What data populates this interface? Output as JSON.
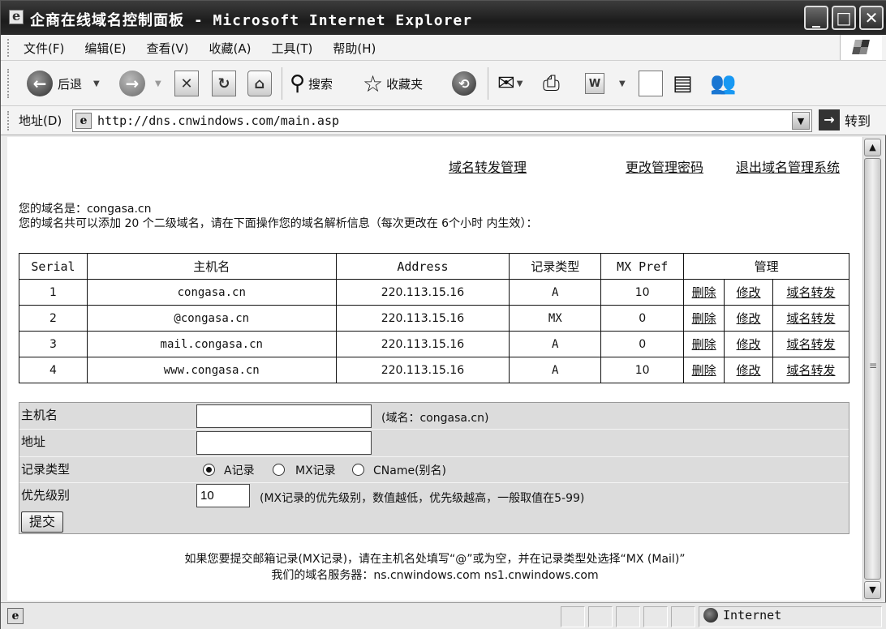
{
  "window": {
    "title": "企商在线域名控制面板 - Microsoft Internet Explorer"
  },
  "menu": [
    "文件(F)",
    "编辑(E)",
    "查看(V)",
    "收藏(A)",
    "工具(T)",
    "帮助(H)"
  ],
  "toolbar": {
    "back_label": "后退",
    "search_label": "搜索",
    "favorites_label": "收藏夹"
  },
  "address": {
    "label": "地址(D)",
    "url": "http://dns.cnwindows.com/main.asp",
    "go_label": "转到"
  },
  "page": {
    "links": [
      "域名转发管理",
      "更改管理密码",
      "退出域名管理系统"
    ],
    "domain_line": "您的域名是：congasa.cn",
    "limit_line": "您的域名共可以添加 20 个二级域名，请在下面操作您的域名解析信息（每次更改在 6个小时 内生效）：",
    "table": {
      "headers": [
        "Serial",
        "主机名",
        "Address",
        "记录类型",
        "MX Pref",
        "管理"
      ],
      "actions": [
        "删除",
        "修改",
        "域名转发"
      ],
      "rows": [
        {
          "serial": "1",
          "host": "congasa.cn",
          "address": "220.113.15.16",
          "type": "A",
          "pref": "10"
        },
        {
          "serial": "2",
          "host": "@congasa.cn",
          "address": "220.113.15.16",
          "type": "MX",
          "pref": "0"
        },
        {
          "serial": "3",
          "host": "mail.congasa.cn",
          "address": "220.113.15.16",
          "type": "A",
          "pref": "0"
        },
        {
          "serial": "4",
          "host": "www.congasa.cn",
          "address": "220.113.15.16",
          "type": "A",
          "pref": "10"
        }
      ]
    },
    "form": {
      "host_label": "主机名",
      "host_value": "",
      "host_hint": "(域名：congasa.cn)",
      "address_label": "地址",
      "address_value": "",
      "type_label": "记录类型",
      "type_options": [
        "A记录",
        "MX记录",
        "CName(别名)"
      ],
      "type_selected": "A记录",
      "priority_label": "优先级别",
      "priority_value": "10",
      "priority_hint": "(MX记录的优先级别，数值越低，优先级越高，一般取值在5-99)",
      "submit_label": "提交"
    },
    "note_line1": "如果您要提交邮箱记录(MX记录)，请在主机名处填写“@”或为空，并在记录类型处选择“MX (Mail)”",
    "note_line2": "我们的域名服务器：ns.cnwindows.com  ns1.cnwindows.com"
  },
  "status": {
    "zone": "Internet"
  }
}
